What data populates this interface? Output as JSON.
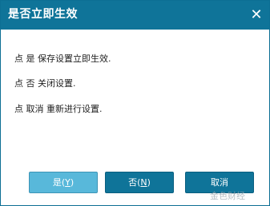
{
  "dialog": {
    "title": "是否立即生效",
    "close_glyph": "✕"
  },
  "messages": [
    "点 是 保存设置立即生效.",
    "点 否 关闭设置.",
    "点 取消 重新进行设置."
  ],
  "buttons": {
    "yes": {
      "label": "是",
      "accel_open": "(",
      "accel": "Y",
      "accel_close": ")"
    },
    "no": {
      "label": "否",
      "accel_open": "(",
      "accel": "N",
      "accel_close": ")"
    },
    "cancel": {
      "label": "取消"
    }
  },
  "watermark": "金色财经",
  "colors": {
    "titlebar": "#0f7499",
    "button": "#0f7499",
    "default_button": "#58b8da"
  }
}
